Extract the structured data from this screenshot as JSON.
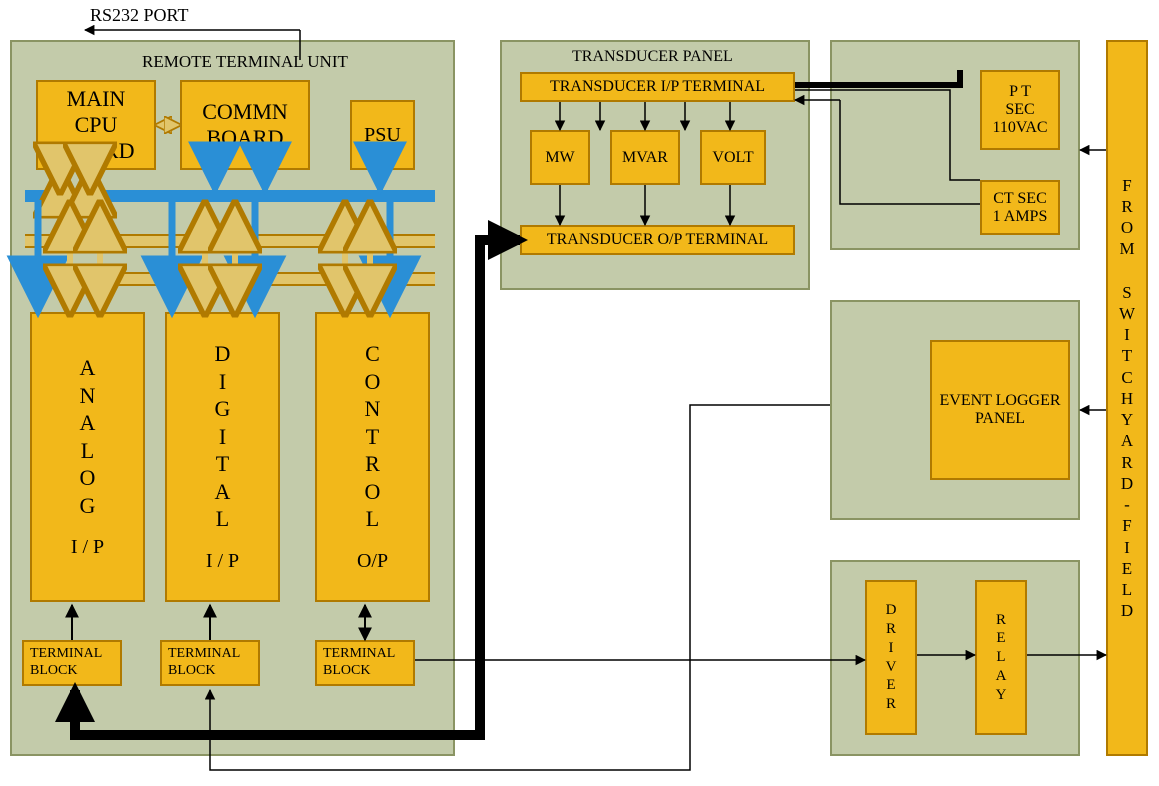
{
  "labels": {
    "rs232": "RS232 PORT",
    "rtu_title": "REMOTE TERMINAL UNIT",
    "cpu": "MAIN\nCPU\nBOARD",
    "commn": "COMMN\nBOARD",
    "psu": "PSU",
    "analog": "A N A L O G   I / P",
    "digital": "D I G I T A L   I / P",
    "control": "C O N T R O L O/P",
    "tblock": "TERMINAL\nBLOCK",
    "transducer_title": "TRANSDUCER  PANEL",
    "trans_ip": "TRANSDUCER  I/P TERMINAL",
    "mw": "MW",
    "mvar": "MVAR",
    "volt": "VOLT",
    "trans_op": "TRANSDUCER O/P TERMINAL",
    "pt": "P T\nSEC\n110VAC",
    "ct": "CT SEC\n1 AMPS",
    "event": "EVENT LOGGER\nPANEL",
    "driver": "D R I V E R",
    "relay": "R E L A Y",
    "from": "F R O M   S W I T C H Y A R D - F I E L D"
  }
}
